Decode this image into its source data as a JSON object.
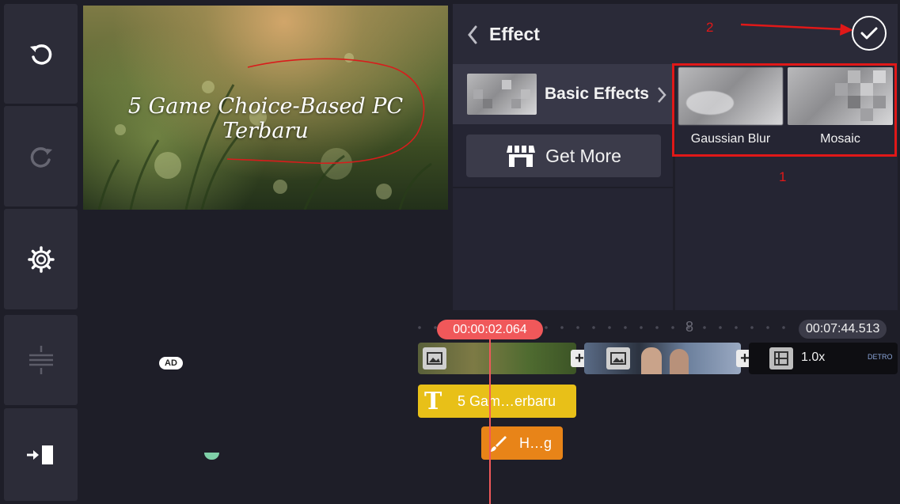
{
  "toolbar": {
    "undo_icon": "undo-icon",
    "redo_icon": "redo-icon",
    "settings_icon": "gear-icon",
    "layer_align_icon": "align-layers-icon",
    "export_icon": "export-icon"
  },
  "preview": {
    "overlay_text": "5 Game Choice-Based PC Terbaru"
  },
  "effect_panel": {
    "title": "Effect",
    "category": "Basic Effects",
    "get_more_label": "Get More",
    "effects": [
      {
        "label": "Gaussian Blur"
      },
      {
        "label": "Mosaic"
      }
    ],
    "annotation_1": "1",
    "annotation_2": "2"
  },
  "timeline": {
    "current_time": "00:00:02.064",
    "total_time": "00:07:44.513",
    "ruler_marker": "8",
    "ad_badge": "AD",
    "speed_label": "1.0x",
    "video_label": "DETRO",
    "text_layer": "5 Gam…erbaru",
    "handwriting_layer": "H…g"
  },
  "colors": {
    "background": "#1e1e28",
    "panel": "#252533",
    "playhead": "#f0585a",
    "text_layer": "#e8c018",
    "handwriting_layer": "#e88418",
    "annotation_red": "#e01818"
  }
}
